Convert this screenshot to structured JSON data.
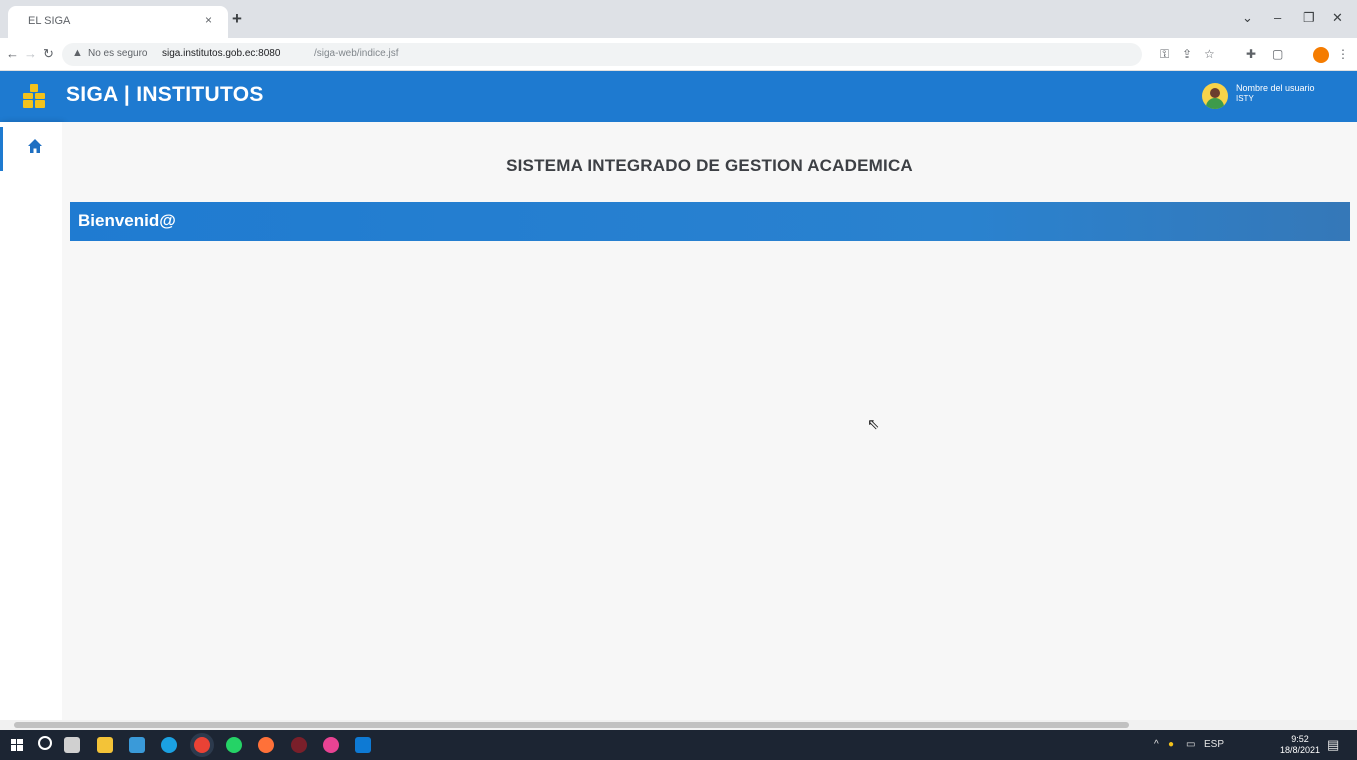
{
  "browser": {
    "tab_title": "EL SIGA",
    "new_tab_symbol": "+",
    "close_symbol": "×",
    "security_label": "No es seguro",
    "url_host": "siga.institutos.gob.ec:8080",
    "url_path": "/siga-web/indice.jsf"
  },
  "header": {
    "title": "SIGA | INSTITUTOS",
    "user_name": "Nombre del usuario",
    "user_code": "ISTY",
    "brand_color": "#1e7ad0",
    "logo_color": "#f4c21b"
  },
  "sidebar": {
    "items": [
      {
        "icon": "home-icon",
        "active": true
      }
    ]
  },
  "main": {
    "system_title": "SISTEMA INTEGRADO DE GESTION ACADEMICA",
    "welcome_label": "Bienvenid@"
  },
  "taskbar": {
    "language": "ESP",
    "time": "9:52",
    "date": "18/8/2021"
  }
}
